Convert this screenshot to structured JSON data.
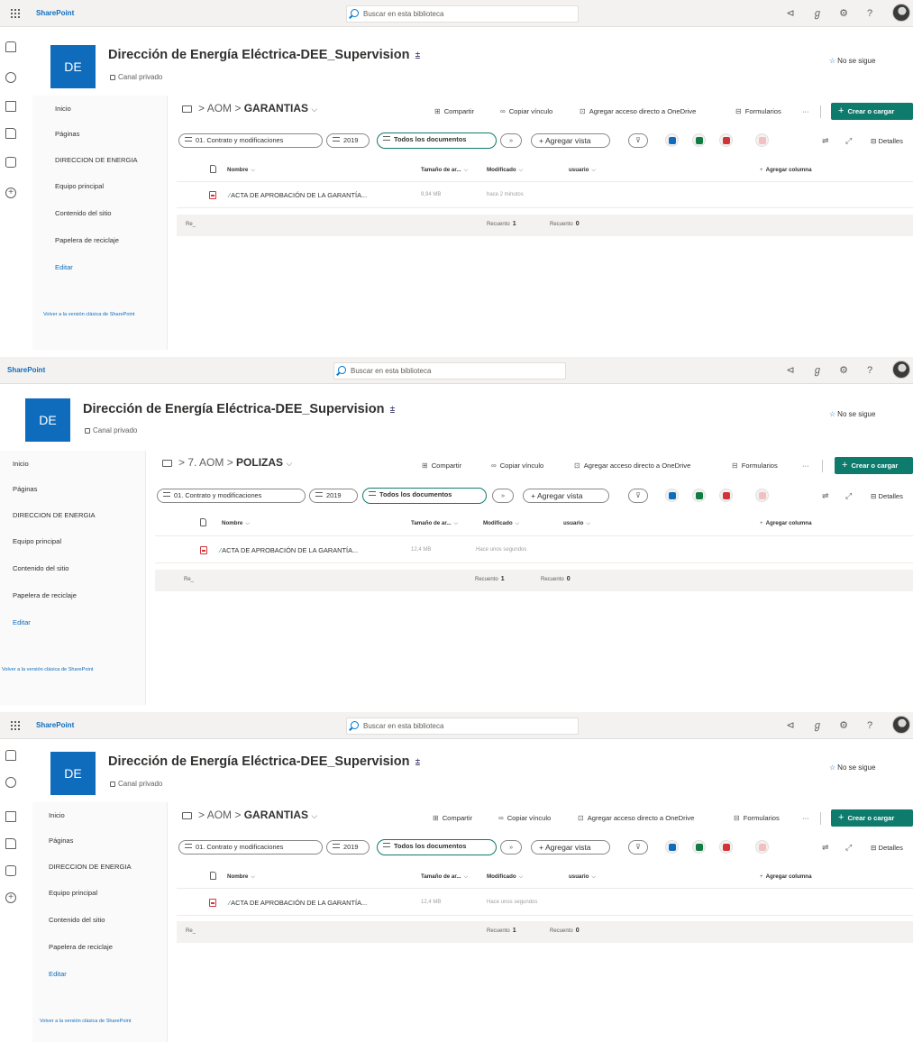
{
  "panels": [
    {
      "brand": "SharePoint",
      "search_placeholder": "Buscar en esta biblioteca",
      "site_logo": "DE",
      "site_title": "Dirección de Energía Eléctrica-DEE_Supervision",
      "privacy": "Canal privado",
      "follow": "No se sigue",
      "nav": [
        "Inicio",
        "Páginas",
        "DIRECCION DE ENERGIA",
        "Equipo principal",
        "Contenido del sitio",
        "Papelera de reciclaje"
      ],
      "nav_edit": "Editar",
      "nav_classic": "Volver a la versión clásica de SharePoint",
      "breadcrumb_parent": "AOM",
      "breadcrumb_current": "GARANTIAS",
      "commands": {
        "share": "Compartir",
        "copy_link": "Copiar vínculo",
        "shortcut": "Agregar acceso directo a OneDrive",
        "forms": "Formularios",
        "more": "···",
        "create": "Crear o cargar"
      },
      "views": [
        "01. Contrato y modificaciones",
        "2019",
        "Todos los documentos"
      ],
      "add_view": "Agregar vista",
      "details": "Detalles",
      "columns": {
        "name": "Nombre",
        "size": "Tamaño de ar...",
        "modified": "Modificado",
        "user": "usuario",
        "add_column": "Agregar columna"
      },
      "file": {
        "name": "ACTA DE APROBACIÓN DE LA GARANTÍA...",
        "size": "9,94 MB",
        "modified": "hace 2 minutos"
      },
      "footer": {
        "left": "Re_",
        "count1_label": "Recuento",
        "count1": "1",
        "count2_label": "Recuento",
        "count2": "0"
      }
    },
    {
      "brand": "SharePoint",
      "search_placeholder": "Buscar en esta biblioteca",
      "site_logo": "DE",
      "site_title": "Dirección de Energía Eléctrica-DEE_Supervision",
      "privacy": "Canal privado",
      "follow": "No se sigue",
      "nav": [
        "Inicio",
        "Páginas",
        "DIRECCION DE ENERGIA",
        "Equipo principal",
        "Contenido del sitio",
        "Papelera de reciclaje"
      ],
      "nav_edit": "Editar",
      "nav_classic": "Volver a la versión clásica de SharePoint",
      "breadcrumb_parent": "7. AOM",
      "breadcrumb_current": "POLIZAS",
      "commands": {
        "share": "Compartir",
        "copy_link": "Copiar vínculo",
        "shortcut": "Agregar acceso directo a OneDrive",
        "forms": "Formularios",
        "more": "···",
        "create": "Crear o cargar"
      },
      "views": [
        "01. Contrato y modificaciones",
        "2019",
        "Todos los documentos"
      ],
      "add_view": "Agregar vista",
      "details": "Detalles",
      "columns": {
        "name": "Nombre",
        "size": "Tamaño de ar...",
        "modified": "Modificado",
        "user": "usuario",
        "add_column": "Agregar columna"
      },
      "file": {
        "name": "ACTA DE APROBACIÓN DE LA GARANTÍA...",
        "size": "12,4 MB",
        "modified": "Hace unos segundos"
      },
      "footer": {
        "left": "Re_",
        "count1_label": "Recuento",
        "count1": "1",
        "count2_label": "Recuento",
        "count2": "0"
      }
    },
    {
      "brand": "SharePoint",
      "search_placeholder": "Buscar en esta biblioteca",
      "site_logo": "DE",
      "site_title": "Dirección de Energía Eléctrica-DEE_Supervision",
      "privacy": "Canal privado",
      "follow": "No se sigue",
      "nav": [
        "Inicio",
        "Páginas",
        "DIRECCION DE ENERGIA",
        "Equipo principal",
        "Contenido del sitio",
        "Papelera de reciclaje"
      ],
      "nav_edit": "Editar",
      "nav_classic": "Volver a la versión clásica de SharePoint",
      "breadcrumb_parent": "AOM",
      "breadcrumb_current": "GARANTIAS",
      "commands": {
        "share": "Compartir",
        "copy_link": "Copiar vínculo",
        "shortcut": "Agregar acceso directo a OneDrive",
        "forms": "Formularios",
        "more": "···",
        "create": "Crear o cargar"
      },
      "views": [
        "01. Contrato y modificaciones",
        "2019",
        "Todos los documentos"
      ],
      "add_view": "Agregar vista",
      "details": "Detalles",
      "columns": {
        "name": "Nombre",
        "size": "Tamaño de ar...",
        "modified": "Modificado",
        "user": "usuario",
        "add_column": "Agregar columna"
      },
      "file": {
        "name": "ACTA DE APROBACIÓN DE LA GARANTÍA...",
        "size": "12,4 MB",
        "modified": "Hace unos segundos"
      },
      "footer": {
        "left": "Re_",
        "count1_label": "Recuento",
        "count1": "1",
        "count2_label": "Recuento",
        "count2": "0"
      }
    }
  ],
  "icons": [
    "app-launcher-icon",
    "search-icon",
    "megaphone-icon",
    "share-people-icon",
    "gear-icon",
    "help-icon",
    "star-icon",
    "lock-icon",
    "teams-icon",
    "folder-icon",
    "pdf-icon",
    "filter-icon"
  ],
  "colors": {
    "brand_blue": "#0f6cbd",
    "create_green": "#0f7b6c",
    "suitebar_bg": "#f3f2f1"
  }
}
